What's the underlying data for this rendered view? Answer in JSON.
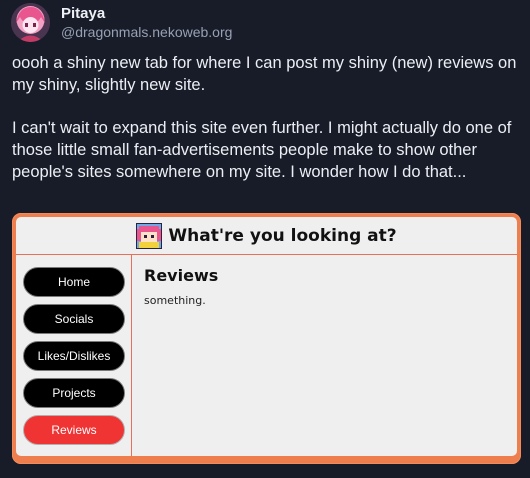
{
  "author": {
    "name": "Pitaya",
    "handle": "@dragonmals.nekoweb.org"
  },
  "post": {
    "paragraphs": [
      "oooh a shiny new tab for where I can post my shiny (new) reviews on my shiny, slightly new site.",
      "I can't wait to expand this site even further. I might actually do one of those little small fan-advertisements people make to show other people's sites somewhere on my site. I wonder how I do that..."
    ]
  },
  "embed": {
    "title": "What're you looking at?",
    "nav": [
      "Home",
      "Socials",
      "Likes/Dislikes",
      "Projects",
      "Reviews"
    ],
    "active_nav": "Reviews",
    "heading": "Reviews",
    "body": "something."
  },
  "colors": {
    "page_background": "#171c28",
    "embed_border": "#ee7e4e",
    "active_button": "#f03333",
    "divider": "#e7705a"
  }
}
